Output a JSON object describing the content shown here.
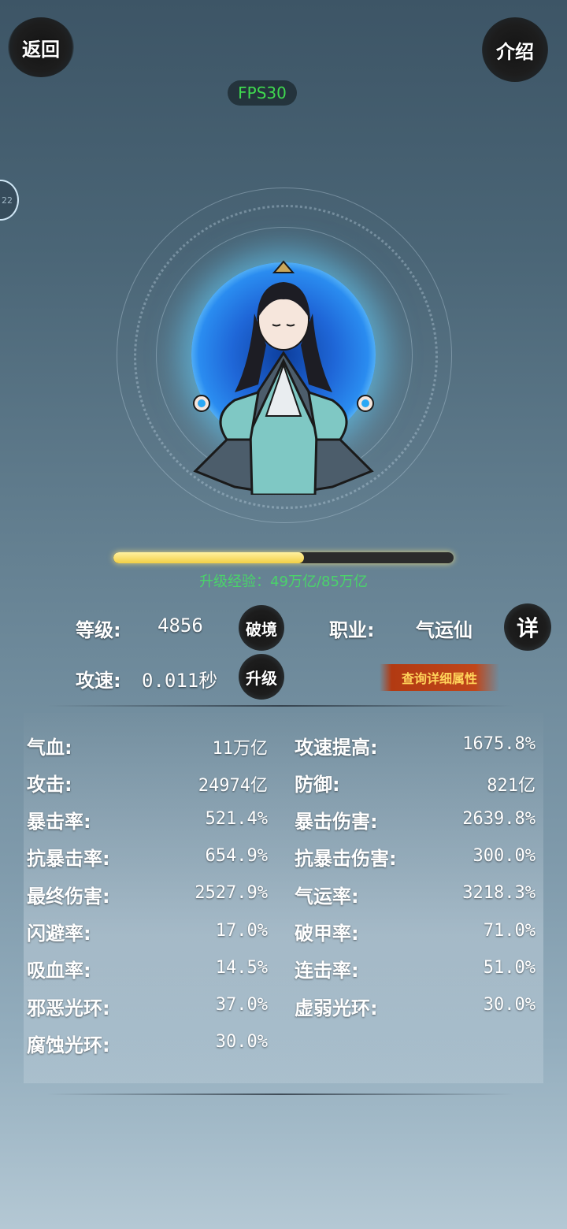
{
  "header": {
    "back_label": "返回",
    "intro_label": "介绍",
    "fps": "FPS30",
    "side_bubble": "22"
  },
  "progress": {
    "fraction": 0.56,
    "text": "升级经验：49万亿/85万亿"
  },
  "info": {
    "level_label": "等级:",
    "level_value": "4856",
    "breakthrough_label": "破境",
    "class_label": "职业:",
    "class_value": "气运仙",
    "class_detail_label": "详",
    "speed_label": "攻速:",
    "speed_value": "0.011秒",
    "upgrade_label": "升级",
    "detail_attr_label": "查询详细属性"
  },
  "stats_left": [
    {
      "name": "气血:",
      "value": "11万亿"
    },
    {
      "name": "攻击:",
      "value": "24974亿"
    },
    {
      "name": "暴击率:",
      "value": "521.4%"
    },
    {
      "name": "抗暴击率:",
      "value": "654.9%"
    },
    {
      "name": "最终伤害:",
      "value": "2527.9%"
    },
    {
      "name": "闪避率:",
      "value": "17.0%"
    },
    {
      "name": "吸血率:",
      "value": "14.5%"
    },
    {
      "name": "邪恶光环:",
      "value": "37.0%"
    },
    {
      "name": "腐蚀光环:",
      "value": "30.0%"
    }
  ],
  "stats_right": [
    {
      "name": "攻速提高:",
      "value": "1675.8%"
    },
    {
      "name": "防御:",
      "value": "821亿"
    },
    {
      "name": "暴击伤害:",
      "value": "2639.8%"
    },
    {
      "name": "抗暴击伤害:",
      "value": "300.0%"
    },
    {
      "name": "气运率:",
      "value": "3218.3%"
    },
    {
      "name": "破甲率:",
      "value": "71.0%"
    },
    {
      "name": "连击率:",
      "value": "51.0%"
    },
    {
      "name": "虚弱光环:",
      "value": "30.0%"
    }
  ]
}
